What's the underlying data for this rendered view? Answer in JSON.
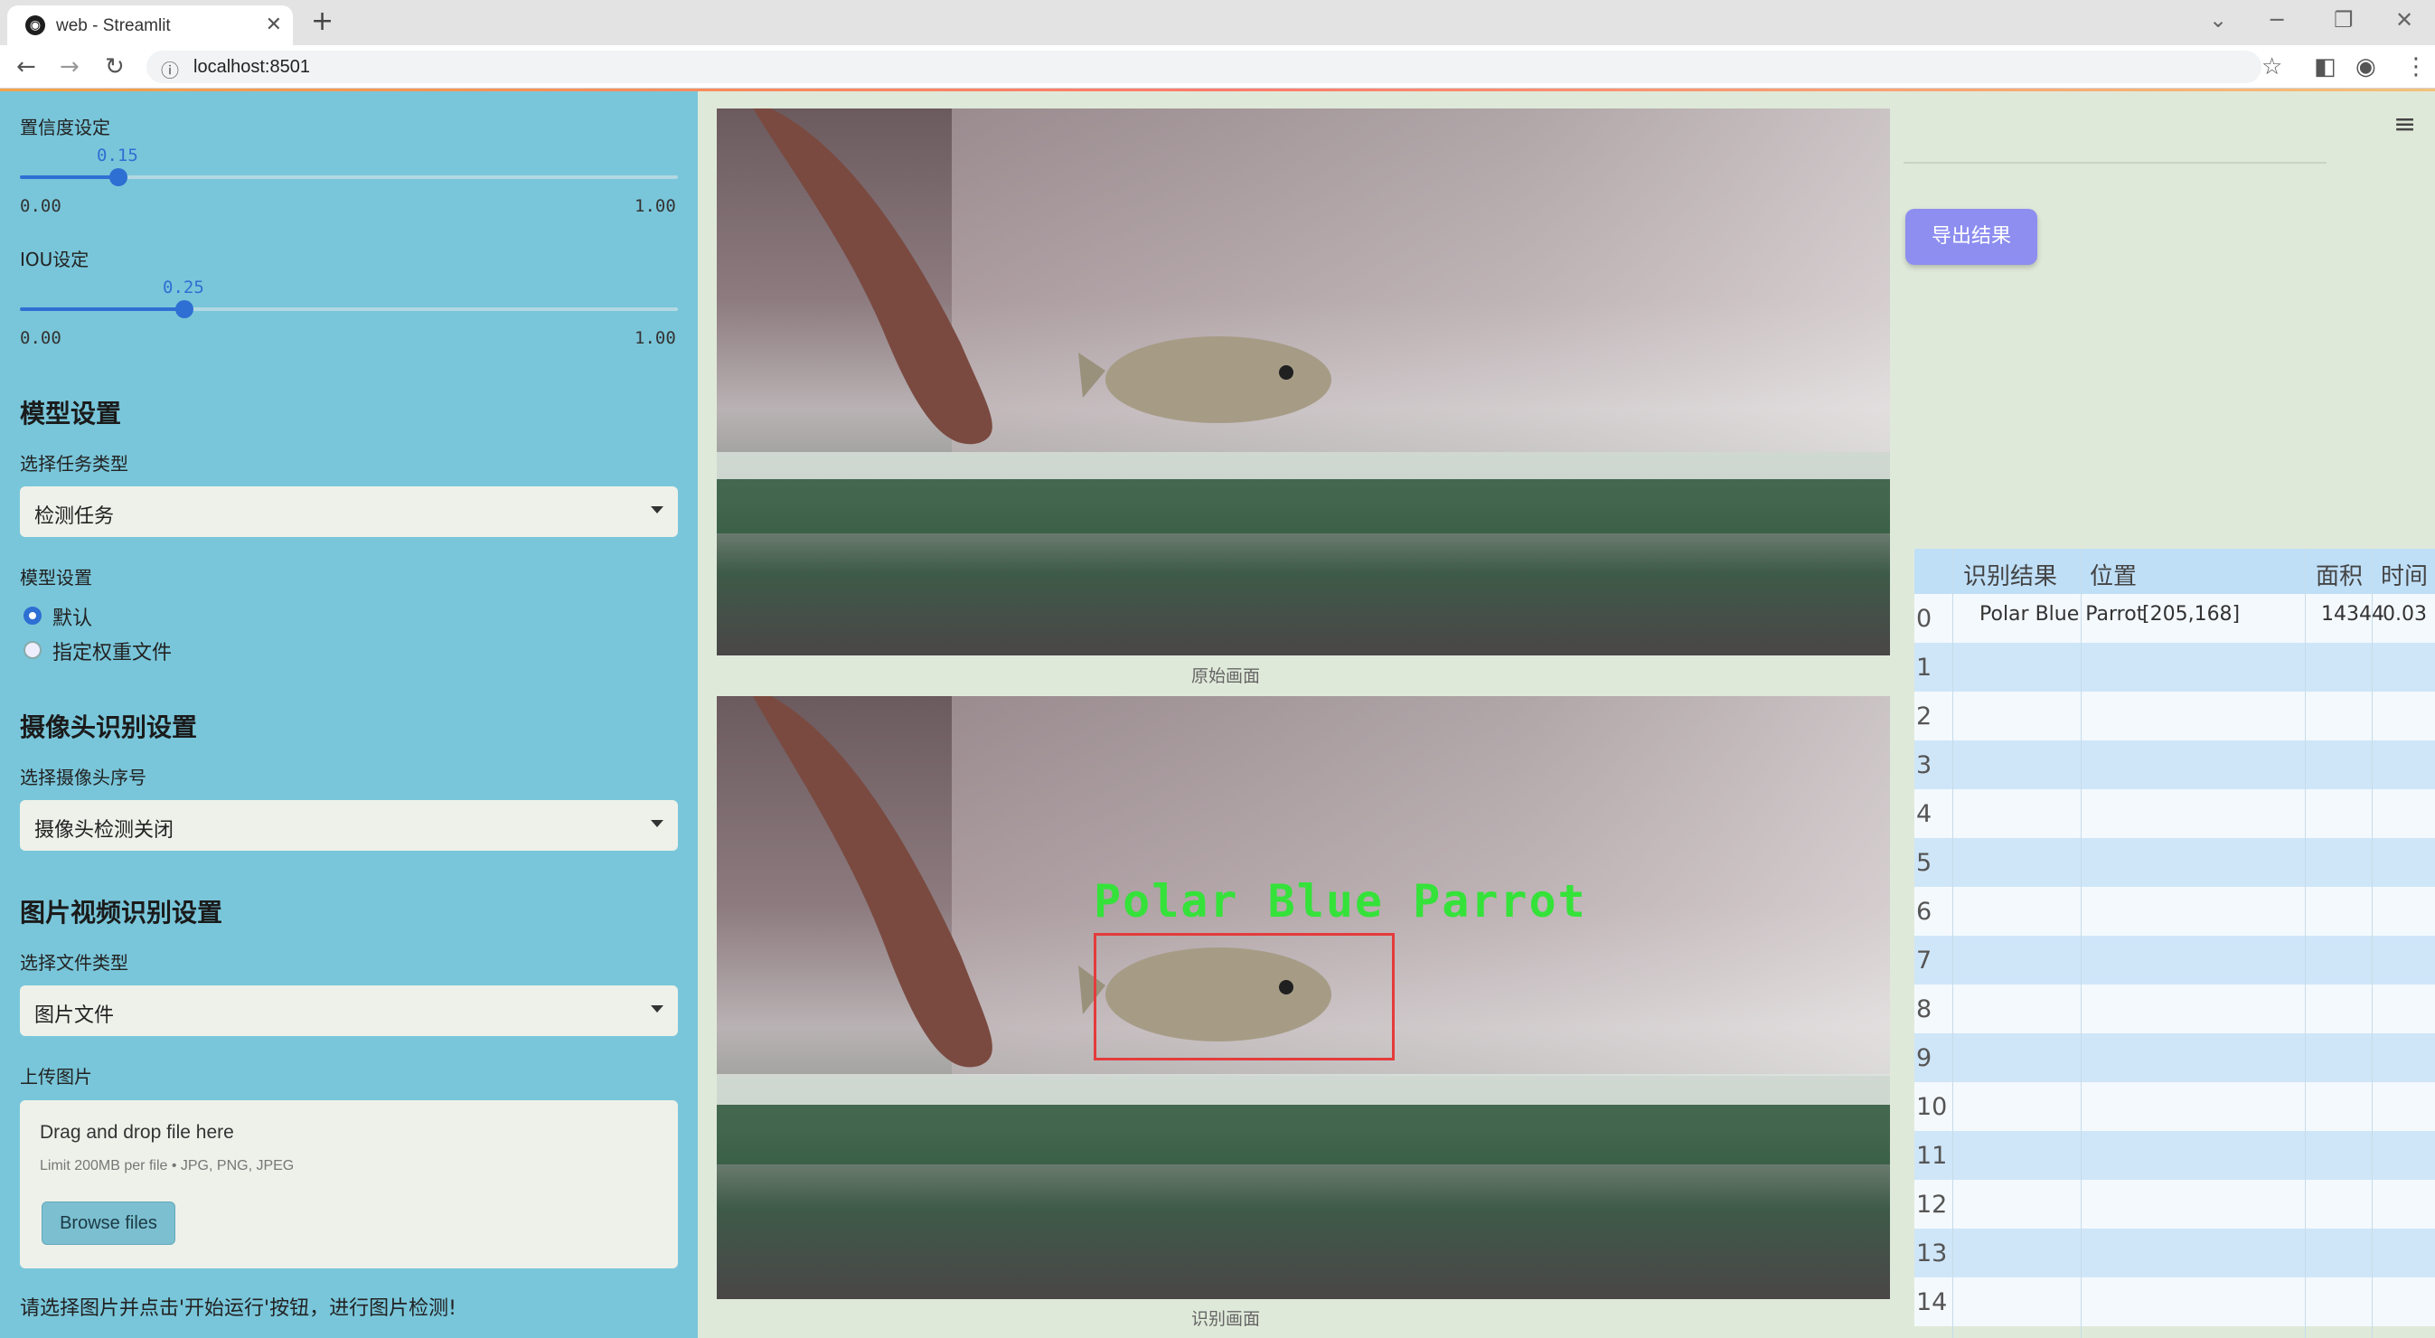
{
  "browser": {
    "tab_title": "web - Streamlit",
    "url": "localhost:8501"
  },
  "sidebar": {
    "confidence": {
      "label": "置信度设定",
      "value": "0.15",
      "fraction": 0.15,
      "min": "0.00",
      "max": "1.00"
    },
    "iou": {
      "label": "IOU设定",
      "value": "0.25",
      "fraction": 0.25,
      "min": "0.00",
      "max": "1.00"
    },
    "model_section": "模型设置",
    "task_type_label": "选择任务类型",
    "task_type_value": "检测任务",
    "model_settings_label": "模型设置",
    "model_options": [
      "默认",
      "指定权重文件"
    ],
    "camera_section": "摄像头识别设置",
    "camera_label": "选择摄像头序号",
    "camera_value": "摄像头检测关闭",
    "media_section": "图片视频识别设置",
    "file_type_label": "选择文件类型",
    "file_type_value": "图片文件",
    "upload_label": "上传图片",
    "uploader": {
      "title": "Drag and drop file here",
      "limit": "Limit 200MB per file • JPG, PNG, JPEG",
      "button": "Browse files"
    },
    "hint": "请选择图片并点击'开始运行'按钮，进行图片检测!"
  },
  "main": {
    "original_caption": "原始画面",
    "result_caption": "识别画面",
    "detection_label": "Polar Blue Parrot"
  },
  "results": {
    "export_button": "导出结果",
    "columns": [
      "识别结果",
      "位置",
      "面积",
      "时间"
    ],
    "rows": [
      {
        "index": "0",
        "result": "Polar Blue Parrot",
        "position": "[205,168]",
        "area": "14344",
        "time": "0.03"
      },
      {
        "index": "1"
      },
      {
        "index": "2"
      },
      {
        "index": "3"
      },
      {
        "index": "4"
      },
      {
        "index": "5"
      },
      {
        "index": "6"
      },
      {
        "index": "7"
      },
      {
        "index": "8"
      },
      {
        "index": "9"
      },
      {
        "index": "10"
      },
      {
        "index": "11"
      },
      {
        "index": "12"
      },
      {
        "index": "13"
      },
      {
        "index": "14"
      }
    ]
  },
  "colors": {
    "sidebar_bg": "#79c6da",
    "accent_blue": "#2e6fd3",
    "export_button": "#8d8ef0",
    "detection_box": "#e43b3b",
    "detection_text": "#35e23a"
  }
}
